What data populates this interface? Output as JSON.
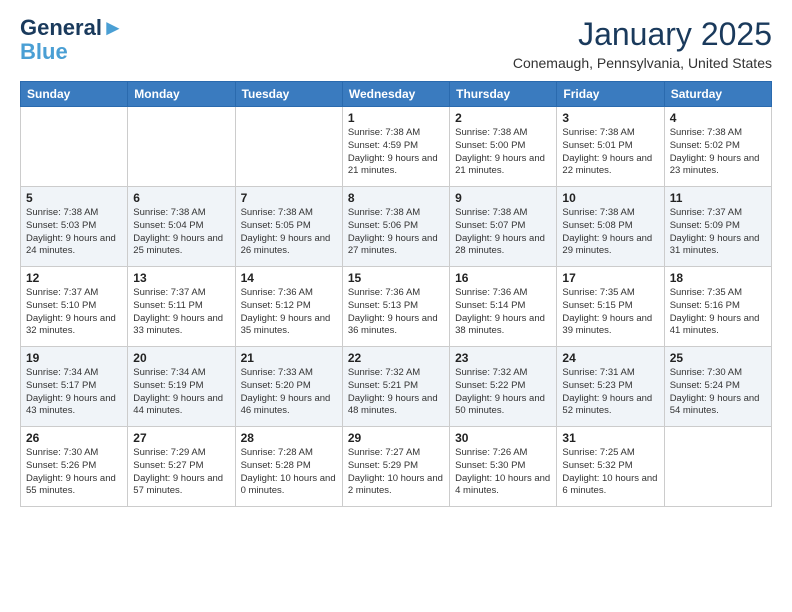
{
  "header": {
    "logo_line1": "General",
    "logo_line2": "Blue",
    "month": "January 2025",
    "location": "Conemaugh, Pennsylvania, United States"
  },
  "weekdays": [
    "Sunday",
    "Monday",
    "Tuesday",
    "Wednesday",
    "Thursday",
    "Friday",
    "Saturday"
  ],
  "weeks": [
    [
      {
        "day": "",
        "sunrise": "",
        "sunset": "",
        "daylight": ""
      },
      {
        "day": "",
        "sunrise": "",
        "sunset": "",
        "daylight": ""
      },
      {
        "day": "",
        "sunrise": "",
        "sunset": "",
        "daylight": ""
      },
      {
        "day": "1",
        "sunrise": "Sunrise: 7:38 AM",
        "sunset": "Sunset: 4:59 PM",
        "daylight": "Daylight: 9 hours and 21 minutes."
      },
      {
        "day": "2",
        "sunrise": "Sunrise: 7:38 AM",
        "sunset": "Sunset: 5:00 PM",
        "daylight": "Daylight: 9 hours and 21 minutes."
      },
      {
        "day": "3",
        "sunrise": "Sunrise: 7:38 AM",
        "sunset": "Sunset: 5:01 PM",
        "daylight": "Daylight: 9 hours and 22 minutes."
      },
      {
        "day": "4",
        "sunrise": "Sunrise: 7:38 AM",
        "sunset": "Sunset: 5:02 PM",
        "daylight": "Daylight: 9 hours and 23 minutes."
      }
    ],
    [
      {
        "day": "5",
        "sunrise": "Sunrise: 7:38 AM",
        "sunset": "Sunset: 5:03 PM",
        "daylight": "Daylight: 9 hours and 24 minutes."
      },
      {
        "day": "6",
        "sunrise": "Sunrise: 7:38 AM",
        "sunset": "Sunset: 5:04 PM",
        "daylight": "Daylight: 9 hours and 25 minutes."
      },
      {
        "day": "7",
        "sunrise": "Sunrise: 7:38 AM",
        "sunset": "Sunset: 5:05 PM",
        "daylight": "Daylight: 9 hours and 26 minutes."
      },
      {
        "day": "8",
        "sunrise": "Sunrise: 7:38 AM",
        "sunset": "Sunset: 5:06 PM",
        "daylight": "Daylight: 9 hours and 27 minutes."
      },
      {
        "day": "9",
        "sunrise": "Sunrise: 7:38 AM",
        "sunset": "Sunset: 5:07 PM",
        "daylight": "Daylight: 9 hours and 28 minutes."
      },
      {
        "day": "10",
        "sunrise": "Sunrise: 7:38 AM",
        "sunset": "Sunset: 5:08 PM",
        "daylight": "Daylight: 9 hours and 29 minutes."
      },
      {
        "day": "11",
        "sunrise": "Sunrise: 7:37 AM",
        "sunset": "Sunset: 5:09 PM",
        "daylight": "Daylight: 9 hours and 31 minutes."
      }
    ],
    [
      {
        "day": "12",
        "sunrise": "Sunrise: 7:37 AM",
        "sunset": "Sunset: 5:10 PM",
        "daylight": "Daylight: 9 hours and 32 minutes."
      },
      {
        "day": "13",
        "sunrise": "Sunrise: 7:37 AM",
        "sunset": "Sunset: 5:11 PM",
        "daylight": "Daylight: 9 hours and 33 minutes."
      },
      {
        "day": "14",
        "sunrise": "Sunrise: 7:36 AM",
        "sunset": "Sunset: 5:12 PM",
        "daylight": "Daylight: 9 hours and 35 minutes."
      },
      {
        "day": "15",
        "sunrise": "Sunrise: 7:36 AM",
        "sunset": "Sunset: 5:13 PM",
        "daylight": "Daylight: 9 hours and 36 minutes."
      },
      {
        "day": "16",
        "sunrise": "Sunrise: 7:36 AM",
        "sunset": "Sunset: 5:14 PM",
        "daylight": "Daylight: 9 hours and 38 minutes."
      },
      {
        "day": "17",
        "sunrise": "Sunrise: 7:35 AM",
        "sunset": "Sunset: 5:15 PM",
        "daylight": "Daylight: 9 hours and 39 minutes."
      },
      {
        "day": "18",
        "sunrise": "Sunrise: 7:35 AM",
        "sunset": "Sunset: 5:16 PM",
        "daylight": "Daylight: 9 hours and 41 minutes."
      }
    ],
    [
      {
        "day": "19",
        "sunrise": "Sunrise: 7:34 AM",
        "sunset": "Sunset: 5:17 PM",
        "daylight": "Daylight: 9 hours and 43 minutes."
      },
      {
        "day": "20",
        "sunrise": "Sunrise: 7:34 AM",
        "sunset": "Sunset: 5:19 PM",
        "daylight": "Daylight: 9 hours and 44 minutes."
      },
      {
        "day": "21",
        "sunrise": "Sunrise: 7:33 AM",
        "sunset": "Sunset: 5:20 PM",
        "daylight": "Daylight: 9 hours and 46 minutes."
      },
      {
        "day": "22",
        "sunrise": "Sunrise: 7:32 AM",
        "sunset": "Sunset: 5:21 PM",
        "daylight": "Daylight: 9 hours and 48 minutes."
      },
      {
        "day": "23",
        "sunrise": "Sunrise: 7:32 AM",
        "sunset": "Sunset: 5:22 PM",
        "daylight": "Daylight: 9 hours and 50 minutes."
      },
      {
        "day": "24",
        "sunrise": "Sunrise: 7:31 AM",
        "sunset": "Sunset: 5:23 PM",
        "daylight": "Daylight: 9 hours and 52 minutes."
      },
      {
        "day": "25",
        "sunrise": "Sunrise: 7:30 AM",
        "sunset": "Sunset: 5:24 PM",
        "daylight": "Daylight: 9 hours and 54 minutes."
      }
    ],
    [
      {
        "day": "26",
        "sunrise": "Sunrise: 7:30 AM",
        "sunset": "Sunset: 5:26 PM",
        "daylight": "Daylight: 9 hours and 55 minutes."
      },
      {
        "day": "27",
        "sunrise": "Sunrise: 7:29 AM",
        "sunset": "Sunset: 5:27 PM",
        "daylight": "Daylight: 9 hours and 57 minutes."
      },
      {
        "day": "28",
        "sunrise": "Sunrise: 7:28 AM",
        "sunset": "Sunset: 5:28 PM",
        "daylight": "Daylight: 10 hours and 0 minutes."
      },
      {
        "day": "29",
        "sunrise": "Sunrise: 7:27 AM",
        "sunset": "Sunset: 5:29 PM",
        "daylight": "Daylight: 10 hours and 2 minutes."
      },
      {
        "day": "30",
        "sunrise": "Sunrise: 7:26 AM",
        "sunset": "Sunset: 5:30 PM",
        "daylight": "Daylight: 10 hours and 4 minutes."
      },
      {
        "day": "31",
        "sunrise": "Sunrise: 7:25 AM",
        "sunset": "Sunset: 5:32 PM",
        "daylight": "Daylight: 10 hours and 6 minutes."
      },
      {
        "day": "",
        "sunrise": "",
        "sunset": "",
        "daylight": ""
      }
    ]
  ]
}
